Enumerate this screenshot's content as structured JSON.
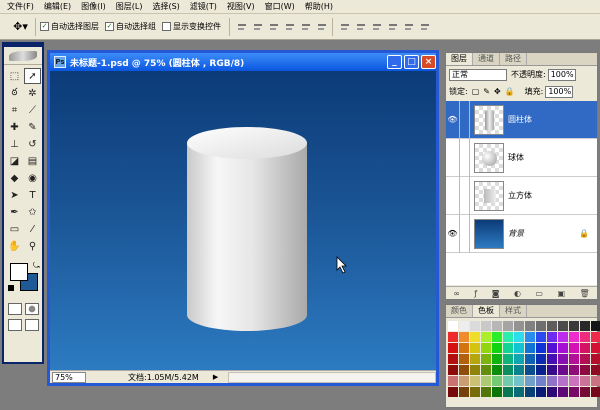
{
  "menu": [
    "文件(F)",
    "编辑(E)",
    "图像(I)",
    "图层(L)",
    "选择(S)",
    "滤镜(T)",
    "视图(V)",
    "窗口(W)",
    "帮助(H)"
  ],
  "options": {
    "auto_select_layer": "自动选择图层",
    "auto_select_group": "自动选择组",
    "show_transform": "显示变换控件"
  },
  "document": {
    "title": "未标题-1.psd @ 75% (圆柱体 , RGB/8)",
    "zoom": "75%",
    "doc_info": "文档:1.05M/5.42M"
  },
  "layers_panel": {
    "tabs": [
      "图层",
      "通道",
      "路径"
    ],
    "blend_mode": "正常",
    "opacity_label": "不透明度:",
    "opacity": "100%",
    "lock_label": "锁定:",
    "fill_label": "填充:",
    "fill": "100%",
    "layers": [
      "圆柱体",
      "球体",
      "立方体",
      "背景"
    ]
  },
  "swatches_panel": {
    "tabs": [
      "颜色",
      "色板",
      "样式"
    ]
  },
  "colors": {
    "foreground": "#ffffff",
    "background": "#1e5a96",
    "accent": "#316ac5"
  }
}
